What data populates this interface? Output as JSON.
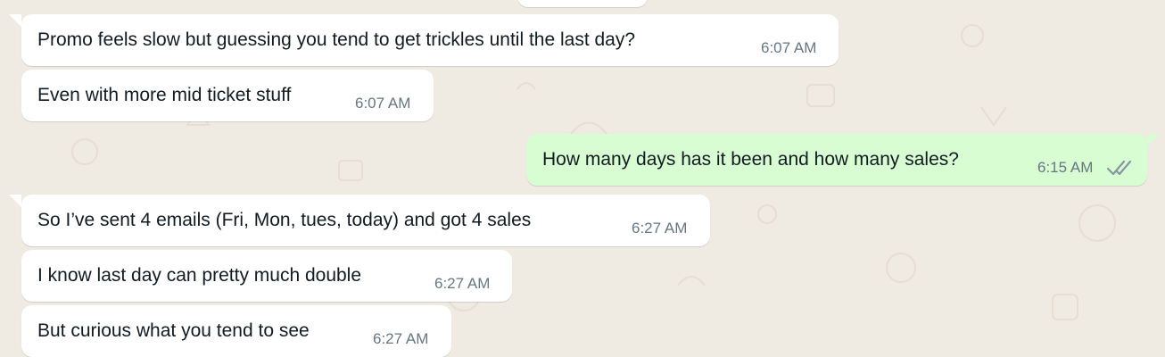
{
  "chat": {
    "messages": [
      {
        "direction": "in",
        "text": "Promo feels slow but guessing you tend to get trickles until the last day?",
        "time": "6:07 AM"
      },
      {
        "direction": "in",
        "text": "Even with more mid ticket stuff",
        "time": "6:07 AM"
      },
      {
        "direction": "out",
        "text": "How many days has it been and how many sales?",
        "time": "6:15 AM",
        "status": "double-check-icon"
      },
      {
        "direction": "in",
        "text": "So I’ve sent 4 emails (Fri, Mon, tues, today) and got 4 sales",
        "time": "6:27 AM"
      },
      {
        "direction": "in",
        "text": "I know last day can pretty much double",
        "time": "6:27 AM"
      },
      {
        "direction": "in",
        "text": "But curious what you tend to see",
        "time": "6:27 AM"
      }
    ]
  },
  "colors": {
    "background": "#efeae2",
    "incoming_bubble": "#ffffff",
    "outgoing_bubble": "#d9fdd3",
    "timestamp": "#667781",
    "ticks": "#8696a0"
  }
}
